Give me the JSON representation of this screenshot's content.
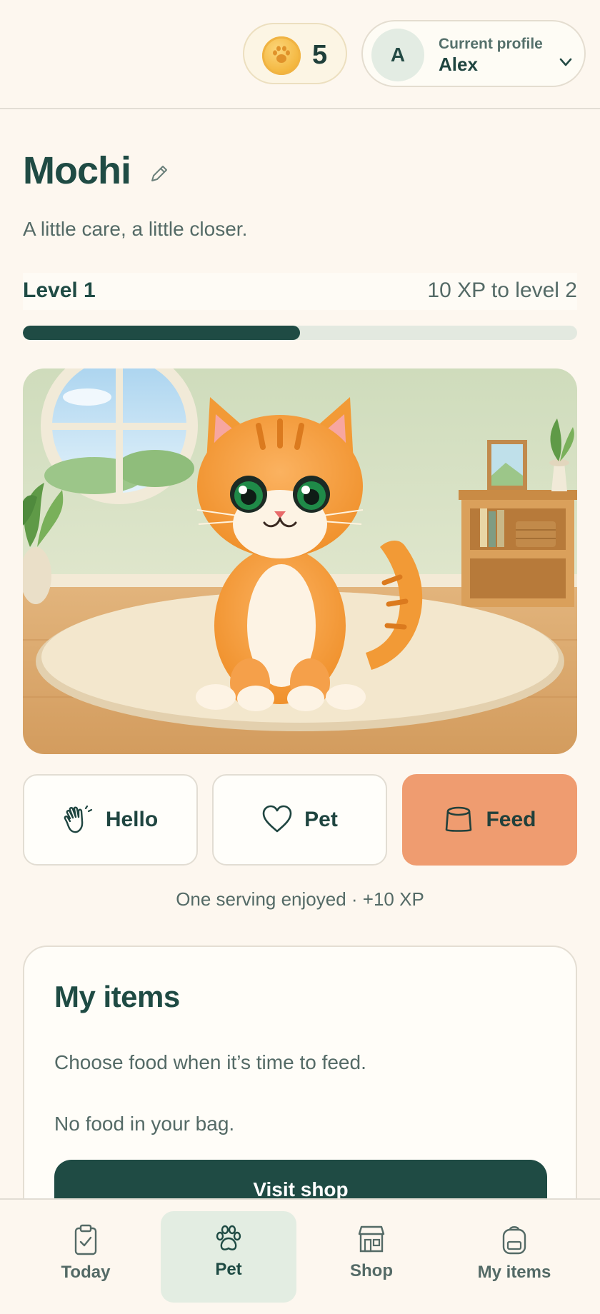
{
  "header": {
    "coins": "5",
    "profile_caption": "Current profile",
    "profile_name": "Alex",
    "avatar_initial": "A"
  },
  "pet": {
    "name": "Mochi",
    "tagline": "A little care, a little closer.",
    "level_label": "Level 1",
    "xp_to_next": "10 XP to level 2",
    "xp_progress": 0.5
  },
  "actions": {
    "hello": "Hello",
    "pet": "Pet",
    "feed": "Feed"
  },
  "status": "One serving enjoyed · +10 XP",
  "items_card": {
    "title": "My items",
    "hint": "Choose food when it’s time to feed.",
    "empty": "No food in your bag.",
    "visit_shop": "Visit shop"
  },
  "nav": {
    "today": "Today",
    "pet": "Pet",
    "shop": "Shop",
    "my_items": "My items",
    "active": "pet"
  },
  "colors": {
    "accent": "#1f4b44",
    "feed": "#ef9c70",
    "background": "#fdf7ef"
  }
}
